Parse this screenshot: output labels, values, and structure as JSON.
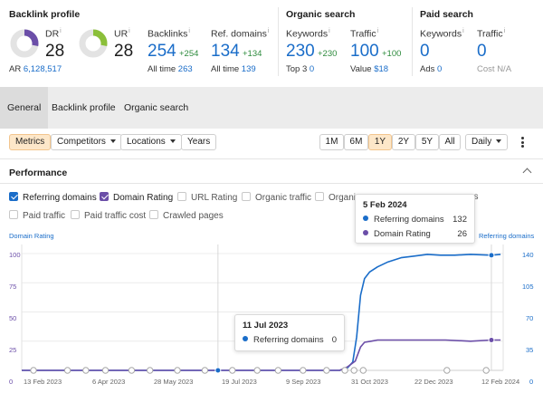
{
  "colors": {
    "accent_blue": "#1a6dc9",
    "accent_purple": "#6b4ea8",
    "positive_green": "#2e8b3d",
    "highlight_orange": "#fde7c9"
  },
  "backlink_profile": {
    "title": "Backlink profile",
    "dr": {
      "label": "DR",
      "info": "i",
      "value": "28",
      "ring_fraction": 0.28
    },
    "ur": {
      "label": "UR",
      "info": "i",
      "value": "28",
      "ring_fraction": 0.28
    },
    "ar": {
      "label": "AR",
      "value": "6,128,517"
    },
    "backlinks": {
      "label": "Backlinks",
      "info": "i",
      "value": "254",
      "delta": "+254",
      "sub_label": "All time",
      "sub_value": "263"
    },
    "ref_domains": {
      "label": "Ref. domains",
      "info": "i",
      "value": "134",
      "delta": "+134",
      "sub_label": "All time",
      "sub_value": "139"
    }
  },
  "organic_search": {
    "title": "Organic search",
    "keywords": {
      "label": "Keywords",
      "info": "i",
      "value": "230",
      "delta": "+230",
      "sub_label": "Top 3",
      "sub_value": "0"
    },
    "traffic": {
      "label": "Traffic",
      "info": "i",
      "value": "100",
      "delta": "+100",
      "sub_label": "Value",
      "sub_value": "$18"
    }
  },
  "paid_search": {
    "title": "Paid search",
    "keywords": {
      "label": "Keywords",
      "info": "i",
      "value": "0",
      "sub_label": "Ads",
      "sub_value": "0"
    },
    "traffic": {
      "label": "Traffic",
      "info": "i",
      "value": "0",
      "sub_label": "Cost",
      "sub_value": "N/A"
    }
  },
  "tabs": [
    "General",
    "Backlink profile",
    "Organic search"
  ],
  "controls": {
    "metrics": "Metrics",
    "competitors": "Competitors",
    "locations": "Locations",
    "years": "Years",
    "ranges": [
      "1M",
      "6M",
      "1Y",
      "2Y",
      "5Y",
      "All"
    ],
    "selected_range": "1Y",
    "interval": "Daily"
  },
  "performance": {
    "title": "Performance",
    "checkboxes": [
      {
        "label": "Referring domains",
        "checked": true
      },
      {
        "label": "Domain Rating",
        "checked": true
      },
      {
        "label": "URL Rating",
        "checked": false
      },
      {
        "label": "Organic traffic",
        "checked": false
      },
      {
        "label": "Organic",
        "checked": false
      },
      {
        "label": "es",
        "checked": false
      },
      {
        "label": "Paid traffic",
        "checked": false
      },
      {
        "label": "Paid traffic cost",
        "checked": false
      },
      {
        "label": "Crawled pages",
        "checked": false
      }
    ]
  },
  "chart_data": {
    "type": "line",
    "left_axis_title": "Domain Rating",
    "right_axis_title": "Referring domains",
    "left_ticks": [
      "0",
      "25",
      "50",
      "75",
      "100"
    ],
    "right_ticks": [
      "0",
      "35",
      "70",
      "105",
      "140"
    ],
    "left_ylim": [
      0,
      100
    ],
    "right_ylim": [
      0,
      140
    ],
    "x_ticks": [
      "13 Feb 2023",
      "6 Apr 2023",
      "28 May 2023",
      "19 Jul 2023",
      "9 Sep 2023",
      "31 Oct 2023",
      "22 Dec 2023",
      "12 Feb 2024"
    ],
    "x_range": [
      "2023-02-11",
      "2024-02-14"
    ],
    "series": [
      {
        "name": "Referring domains",
        "axis": "right",
        "color": "#1a6dc9",
        "points": [
          [
            "2023-02-11",
            0
          ],
          [
            "2023-10-12",
            0
          ],
          [
            "2023-10-18",
            3
          ],
          [
            "2023-10-22",
            10
          ],
          [
            "2023-10-25",
            40
          ],
          [
            "2023-10-28",
            90
          ],
          [
            "2023-10-31",
            110
          ],
          [
            "2023-11-04",
            118
          ],
          [
            "2023-11-10",
            124
          ],
          [
            "2023-11-18",
            130
          ],
          [
            "2023-11-28",
            135
          ],
          [
            "2023-12-08",
            137
          ],
          [
            "2023-12-18",
            139
          ],
          [
            "2023-12-28",
            138
          ],
          [
            "2024-01-08",
            138
          ],
          [
            "2024-01-20",
            139
          ],
          [
            "2024-02-05",
            138
          ],
          [
            "2024-02-12",
            139
          ]
        ]
      },
      {
        "name": "Domain Rating",
        "axis": "left",
        "color": "#6b4ea8",
        "points": [
          [
            "2023-02-11",
            0
          ],
          [
            "2023-10-12",
            0
          ],
          [
            "2023-10-18",
            3
          ],
          [
            "2023-10-24",
            8
          ],
          [
            "2023-10-28",
            20
          ],
          [
            "2023-10-31",
            24
          ],
          [
            "2023-11-05",
            25
          ],
          [
            "2023-11-10",
            26
          ],
          [
            "2023-12-01",
            26
          ],
          [
            "2024-01-01",
            26
          ],
          [
            "2024-01-20",
            25
          ],
          [
            "2024-02-05",
            26
          ],
          [
            "2024-02-12",
            26
          ]
        ]
      }
    ],
    "tooltips": [
      {
        "date": "5 Feb 2024",
        "rows": [
          {
            "label": "Referring domains",
            "value": "132"
          },
          {
            "label": "Domain Rating",
            "value": "26"
          }
        ]
      },
      {
        "date": "11 Jul 2023",
        "rows": [
          {
            "label": "Referring domains",
            "value": "0"
          }
        ]
      }
    ]
  }
}
